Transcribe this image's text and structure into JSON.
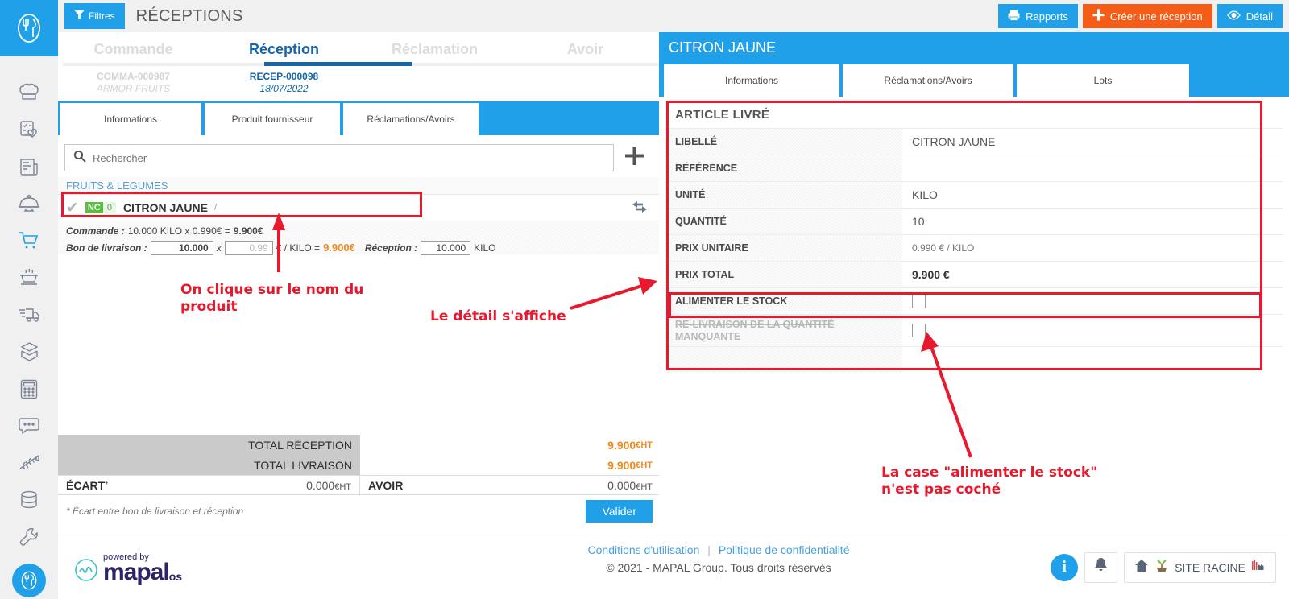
{
  "topbar": {
    "filters_label": "Filtres",
    "page_title": "RÉCEPTIONS",
    "buttons": [
      {
        "label": "Rapports",
        "icon": "printer-icon",
        "color": "#1fa0e8"
      },
      {
        "label": "Créer une réception",
        "icon": "plus-icon",
        "color": "#f45c18"
      },
      {
        "label": "Détail",
        "icon": "eye-icon",
        "color": "#1fa0e8"
      }
    ]
  },
  "sidebar": {
    "items": [
      {
        "icon": "chef-hat-icon",
        "active": false
      },
      {
        "icon": "recipe-favorite-icon",
        "active": false
      },
      {
        "icon": "document-icon",
        "active": false
      },
      {
        "icon": "dish-cover-icon",
        "active": false
      },
      {
        "icon": "shopping-cart-icon",
        "active": true
      },
      {
        "icon": "cooking-pot-icon",
        "active": false
      },
      {
        "icon": "delivery-truck-icon",
        "active": false
      },
      {
        "icon": "layers-box-icon",
        "active": false
      },
      {
        "icon": "calculator-icon",
        "active": false
      },
      {
        "icon": "chat-bubble-icon",
        "active": false
      },
      {
        "icon": "fish-bone-icon",
        "active": false
      },
      {
        "icon": "database-icon",
        "active": false
      },
      {
        "icon": "wrench-icon",
        "active": false
      }
    ]
  },
  "main_tabs": [
    {
      "label": "Commande",
      "selected": false
    },
    {
      "label": "Réception",
      "selected": true
    },
    {
      "label": "Réclamation",
      "selected": false
    },
    {
      "label": "Avoir",
      "selected": false
    }
  ],
  "subheader": [
    {
      "line1": "COMMA-000987",
      "line2": "ARMOR FRUITS",
      "selected": false
    },
    {
      "line1": "RECEP-000098",
      "line2": "18/07/2022",
      "selected": true
    },
    {
      "line1": "",
      "line2": "",
      "selected": false
    },
    {
      "line1": "",
      "line2": "",
      "selected": false
    }
  ],
  "left_sub_tabs": [
    {
      "label": "Informations"
    },
    {
      "label": "Produit fournisseur"
    },
    {
      "label": "Réclamations/Avoirs"
    }
  ],
  "search": {
    "placeholder": "Rechercher",
    "value": "",
    "icon": "search-icon",
    "add_icon": "plus-icon"
  },
  "product_list": {
    "category": "FRUITS & LEGUMES",
    "row": {
      "check_icon": "check-icon",
      "badge": "NC",
      "badge_count": "0",
      "name": "CITRON JAUNE",
      "separator": "/",
      "swap_icon": "swap-arrows-icon"
    },
    "quantities": {
      "commande_label": "Commande :",
      "commande_text": "10.000 KILO x  0.990€ =",
      "commande_total": "9.900€",
      "bl_label": "Bon de livraison :",
      "bl_qty": "10.000",
      "multiply": "x",
      "bl_price": "0.99",
      "unit_expr": "€ / KILO =",
      "bl_total": "9.900€",
      "reception_label": "Réception :",
      "reception_qty": "10.000",
      "reception_unit": "KILO"
    }
  },
  "totals": {
    "rows": [
      {
        "label": "TOTAL RÉCEPTION",
        "value": "9.900",
        "suffix": "€HT"
      },
      {
        "label": "TOTAL LIVRAISON",
        "value": "9.900",
        "suffix": "€HT"
      }
    ],
    "ecart_label": "ÉCART",
    "ecart_star": "*",
    "ecart_value": "0.000",
    "ecart_suffix": "€HT",
    "avoir_label": "AVOIR",
    "avoir_value": "0.000",
    "avoir_suffix": "€HT",
    "note": "* Écart entre bon de livraison et réception",
    "validate_label": "Valider"
  },
  "footer": {
    "powered_by": "powered by",
    "brand": "mapal",
    "brand_suffix": "os",
    "terms_link": "Conditions d'utilisation",
    "separator": "|",
    "privacy_link": "Politique de confidentialité",
    "copyright": "© 2021 - MAPAL Group. Tous droits réservés",
    "info_icon": "info-icon",
    "bell_icon": "bell-icon",
    "home_icon": "home-icon",
    "plant_icon": "plant-icon",
    "site_label": "SITE RACINE",
    "factory_icon": "factory-icon"
  },
  "right_panel": {
    "title": "CITRON JAUNE",
    "tabs": [
      {
        "label": "Informations"
      },
      {
        "label": "Réclamations/Avoirs"
      },
      {
        "label": "Lots"
      }
    ],
    "section_title": "ARTICLE LIVRÉ",
    "rows": [
      {
        "key": "LIBELLÉ",
        "value": "CITRON JAUNE",
        "type": "text"
      },
      {
        "key": "RÉFÉRENCE",
        "value": "",
        "type": "text"
      },
      {
        "key": "UNITÉ",
        "value": "KILO",
        "type": "text"
      },
      {
        "key": "QUANTITÉ",
        "value": "10",
        "type": "text"
      },
      {
        "key": "PRIX UNITAIRE",
        "value": "0.990 € / KILO",
        "type": "small"
      },
      {
        "key": "PRIX TOTAL",
        "value": "9.900 €",
        "type": "bold"
      },
      {
        "key": "ALIMENTER LE STOCK",
        "value": "",
        "type": "checkbox",
        "checked": false
      },
      {
        "key": "RE-LIVRAISON DE LA QUANTITÉ MANQUANTE",
        "key_line1": "RE-LIVRAISON DE LA QUANTITÉ",
        "key_line2": "MANQUANTE",
        "value": "",
        "type": "checkbox",
        "checked": false,
        "disabled": true
      }
    ]
  },
  "annotations": [
    {
      "id": "anno-click-product",
      "text_line1": "On clique sur le nom du",
      "text_line2": "produit",
      "color": "#e8192c"
    },
    {
      "id": "anno-detail-shows",
      "text_line1": "Le détail s'affiche",
      "text_line2": "",
      "color": "#e8192c"
    },
    {
      "id": "anno-checkbox-unchecked",
      "text_line1": "La case \"alimenter le stock\"",
      "text_line2": "n'est pas coché",
      "color": "#e8192c"
    }
  ]
}
